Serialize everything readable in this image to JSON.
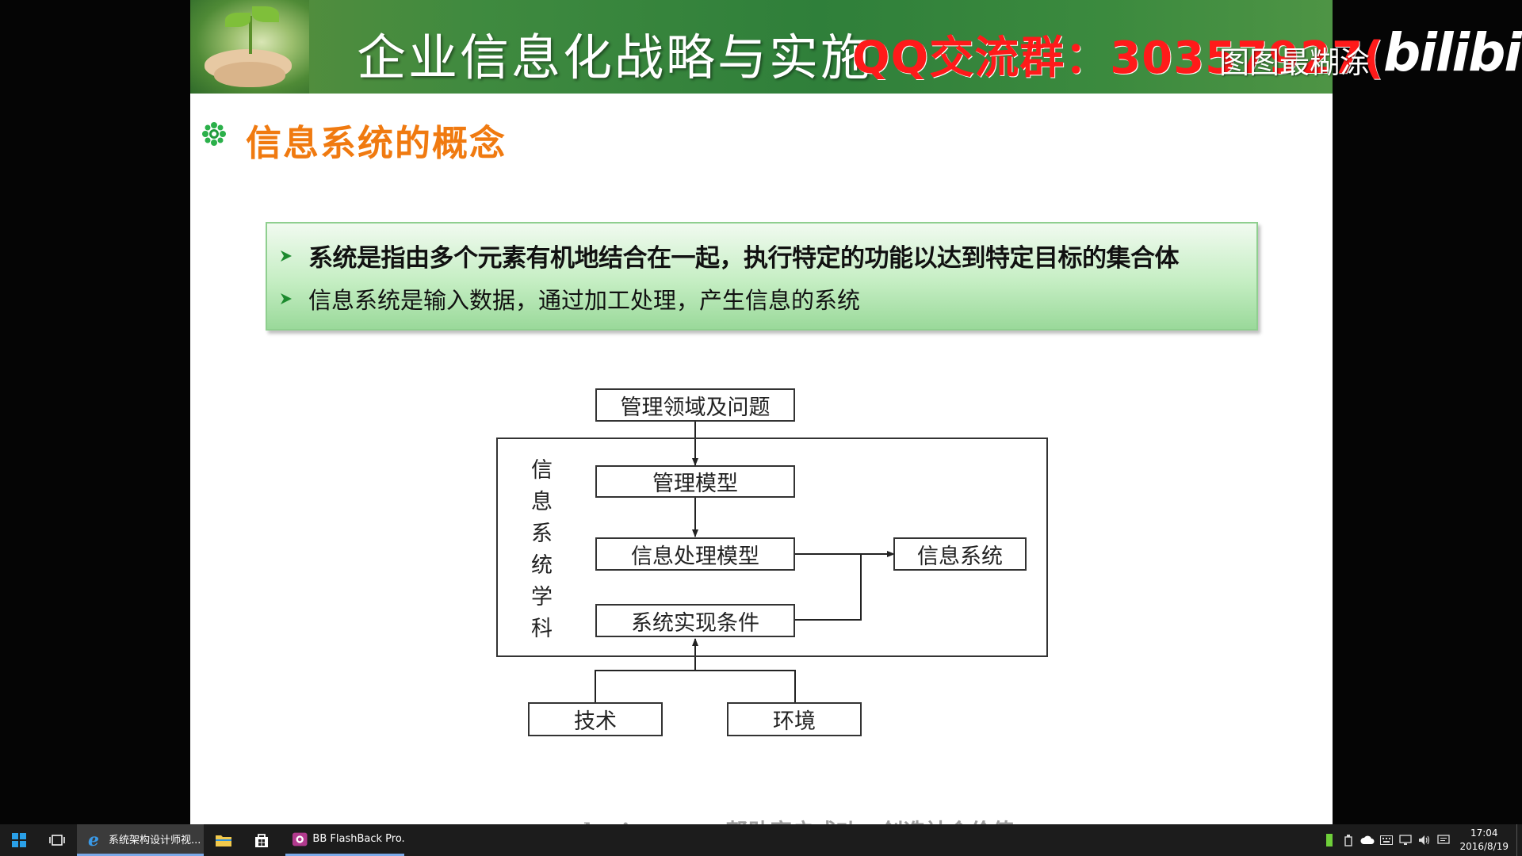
{
  "slide": {
    "banner_title": "企业信息化战略与实施",
    "section_title": "信息系统的概念",
    "bullets": [
      "系统是指由多个元素有机地结合在一起，执行特定的功能以达到特定目标的集合体",
      "信息系统是输入数据，通过加工处理，产生信息的系统"
    ],
    "footer": "www.educity.cn — 帮助客户成功，创造社会价值",
    "colors": {
      "banner": "#3f8a3f",
      "section_title": "#f07a10",
      "concept_box": "#c5eec3"
    }
  },
  "diagram": {
    "top_box": "管理领域及问题",
    "model_box": "管理模型",
    "processing_box": "信息处理模型",
    "conditions_box": "系统实现条件",
    "output_box": "信息系统",
    "frame_label": "信息系统学科",
    "tech_box": "技术",
    "env_box": "环境"
  },
  "overlays": {
    "qq_group": "QQ交流群：30357927(",
    "blur_note": "图图最糊涂",
    "platform_logo": "bilibili"
  },
  "taskbar": {
    "apps": [
      {
        "label": "系统架构设计师视...",
        "icon": "ie-icon"
      },
      {
        "label": "",
        "icon": "file-explorer-icon"
      },
      {
        "label": "",
        "icon": "store-icon"
      },
      {
        "label": "BB FlashBack Pro...",
        "icon": "flashback-icon"
      }
    ],
    "clock_time": "17:04",
    "clock_date": "2016/8/19"
  }
}
